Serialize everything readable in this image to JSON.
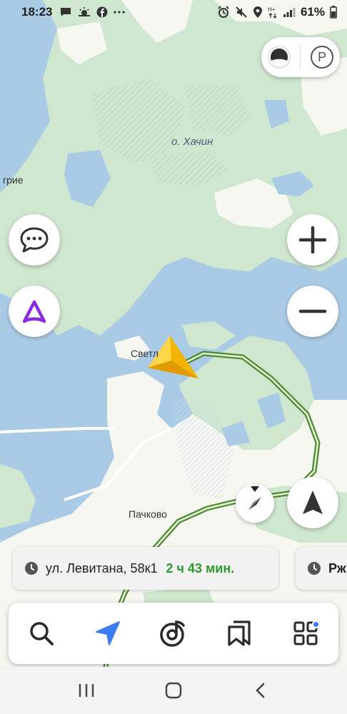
{
  "status_bar": {
    "time": "18:23",
    "battery_text": "61%",
    "left_icons": [
      "chat-icon",
      "weather-icon",
      "facebook-icon",
      "more-icon"
    ],
    "right_icons": [
      "alarm-icon",
      "mute-icon",
      "location-icon",
      "data-icon",
      "signal-icon",
      "battery-icon"
    ]
  },
  "map": {
    "labels": {
      "lake": "о. Хачин",
      "left_edge": "грие",
      "village1": "Светл",
      "village2": "Пачково"
    }
  },
  "controls": {
    "layers_icon": "layers-icon",
    "parking_label": "P",
    "zoom_in_icon": "plus-icon",
    "zoom_out_icon": "minus-icon",
    "chat_icon": "chat-bubble-icon",
    "alice_icon": "alice-icon",
    "locate_icon": "navigation-arrow-icon",
    "compass_icon": "compass-icon"
  },
  "route_cards": [
    {
      "icon": "clock-icon",
      "address": "ул. Левитана, 58к1",
      "eta": "2 ч 43 мин."
    },
    {
      "icon": "clock-icon",
      "address": "Рж"
    }
  ],
  "toolbar": {
    "items": [
      "search-icon",
      "navigator-icon",
      "music-icon",
      "bookmarks-icon",
      "services-icon"
    ]
  },
  "nav_bar": {
    "items": [
      "recent-apps-icon",
      "home-icon",
      "back-icon"
    ]
  },
  "colors": {
    "water": "#aacbe6",
    "forest": "#cfe6cf",
    "land": "#f7f7f2",
    "route": "#5a9a3a",
    "accent": "#3d7cf4",
    "eta": "#2e9a2e",
    "alice": "#8a2be2"
  }
}
